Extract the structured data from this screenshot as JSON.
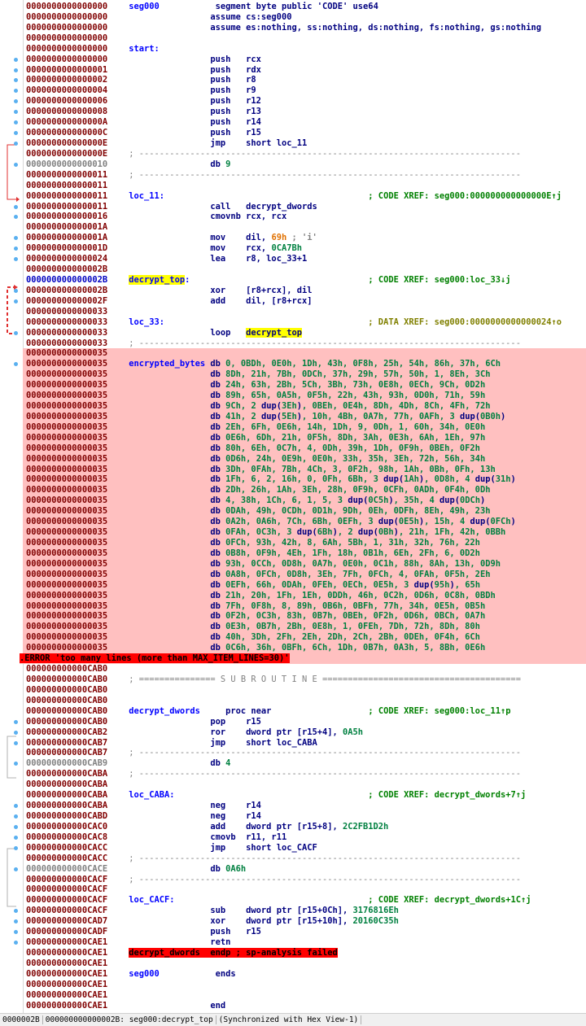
{
  "view": "IDA View (disassembly listing)",
  "status_bar": {
    "offset": "0000002B",
    "location": "000000000000002B: seg000:decrypt_top",
    "sync": "(Synchronized with Hex View-1)"
  },
  "lines": [
    {
      "addr": "0000000000000000",
      "label": "seg000",
      "code": "segment byte public 'CODE' use64",
      "kind": "dir"
    },
    {
      "addr": "0000000000000000",
      "code": "assume cs:seg000",
      "kind": "dir"
    },
    {
      "addr": "0000000000000000",
      "code": "assume es:nothing, ss:nothing, ds:nothing, fs:nothing, gs:nothing",
      "kind": "dir"
    },
    {
      "addr": "0000000000000000"
    },
    {
      "addr": "0000000000000000",
      "label": "start:"
    },
    {
      "addr": "0000000000000000",
      "mn": "push",
      "ops": "rcx",
      "dot": true
    },
    {
      "addr": "0000000000000001",
      "mn": "push",
      "ops": "rdx",
      "dot": true
    },
    {
      "addr": "0000000000000002",
      "mn": "push",
      "ops": "r8",
      "dot": true
    },
    {
      "addr": "0000000000000004",
      "mn": "push",
      "ops": "r9",
      "dot": true
    },
    {
      "addr": "0000000000000006",
      "mn": "push",
      "ops": "r12",
      "dot": true
    },
    {
      "addr": "0000000000000008",
      "mn": "push",
      "ops": "r13",
      "dot": true
    },
    {
      "addr": "000000000000000A",
      "mn": "push",
      "ops": "r14",
      "dot": true
    },
    {
      "addr": "000000000000000C",
      "mn": "push",
      "ops": "r15",
      "dot": true
    },
    {
      "addr": "000000000000000E",
      "mn": "jmp",
      "ops": "short loc_11",
      "dot": true
    },
    {
      "addr": "000000000000000E",
      "sep": "dash"
    },
    {
      "addr": "0000000000000010",
      "gray": true,
      "mn": "db",
      "num": "9",
      "dot": true
    },
    {
      "addr": "0000000000000011",
      "sep": "dash"
    },
    {
      "addr": "0000000000000011"
    },
    {
      "addr": "0000000000000011",
      "label": "loc_11:",
      "xref": "; CODE XREF: seg000:000000000000000E↑j"
    },
    {
      "addr": "0000000000000011",
      "mn": "call",
      "ops": "decrypt_dwords",
      "dot": true
    },
    {
      "addr": "0000000000000016",
      "mn": "cmovnb",
      "ops": "rcx, rcx",
      "dot": true
    },
    {
      "addr": "000000000000001A"
    },
    {
      "addr": "000000000000001A",
      "mn": "mov",
      "ops": "dil, ",
      "num_orange": "69h",
      "cmt": " ; 'i'",
      "dot": true
    },
    {
      "addr": "000000000000001D",
      "mn": "mov",
      "ops": "rcx, ",
      "num": "0CA7Bh",
      "dot": true
    },
    {
      "addr": "0000000000000024",
      "mn": "lea",
      "ops": "r8, loc_33+1",
      "dot": true
    },
    {
      "addr": "000000000000002B"
    },
    {
      "addr": "000000000000002B",
      "blue_addr": true,
      "label_hl": "decrypt_top",
      "label_suffix": ":",
      "xref": "; CODE XREF: seg000:loc_33↓j"
    },
    {
      "addr": "000000000000002B",
      "mn": "xor",
      "ops": "[r8+rcx], dil",
      "dot": true
    },
    {
      "addr": "000000000000002F",
      "mn": "add",
      "ops": "dil, [r8+rcx]",
      "dot": true
    },
    {
      "addr": "0000000000000033"
    },
    {
      "addr": "0000000000000033",
      "label": "loc_33:",
      "dxref": "; DATA XREF: seg000:0000000000000024↑o"
    },
    {
      "addr": "0000000000000033",
      "mn": "loop",
      "ops_hl": "decrypt_top",
      "dot": true
    },
    {
      "addr": "0000000000000033",
      "sep": "dash"
    }
  ],
  "encrypted": {
    "addr": "0000000000000035",
    "label": "encrypted_bytes",
    "rows": [
      "0, 0BDh, 0E0h, 1Dh, 43h, 0F8h, 25h, 54h, 86h, 37h, 6Ch",
      "8Dh, 21h, 7Bh, 0DCh, 37h, 29h, 57h, 50h, 1, 8Eh, 3Ch",
      "24h, 63h, 2Bh, 5Ch, 3Bh, 73h, 0E8h, 0ECh, 9Ch, 0D2h",
      "89h, 65h, 0A5h, 0F5h, 22h, 43h, 93h, 0D0h, 71h, 59h",
      "9Ch, 2 dup(3Eh), 0BEh, 0E4h, 8Dh, 4Dh, 8Ch, 4Fh, 72h",
      "41h, 2 dup(5Eh), 10h, 4Bh, 0A7h, 77h, 0AFh, 3 dup(0B0h)",
      "2Eh, 6Fh, 0E6h, 14h, 1Dh, 9, 0Dh, 1, 60h, 34h, 0E0h",
      "0E6h, 6Dh, 21h, 0F5h, 8Dh, 3Ah, 0E3h, 6Ah, 1Eh, 97h",
      "80h, 6Eh, 0C7h, 4, 0Dh, 39h, 1Dh, 0F9h, 0BEh, 0F2h",
      "0D6h, 24h, 0E9h, 0E0h, 33h, 35h, 3Eh, 72h, 56h, 34h",
      "3Dh, 0FAh, 7Bh, 4Ch, 3, 0F2h, 98h, 1Ah, 0Bh, 0Fh, 13h",
      "1Fh, 6, 2, 16h, 0, 0Fh, 6Bh, 3 dup(1Ah), 0D8h, 4 dup(31h)",
      "2Dh, 26h, 1Ah, 3Eh, 28h, 0F9h, 0CFh, 0ADh, 0F4h, 0Dh",
      "4, 38h, 1Ch, 6, 1, 5, 3 dup(0C5h), 35h, 4 dup(0DCh)",
      "0DAh, 49h, 0CDh, 0D1h, 9Dh, 0Eh, 0DFh, 8Eh, 49h, 23h",
      "0A2h, 0A6h, 7Ch, 6Bh, 0EFh, 3 dup(0E5h), 15h, 4 dup(0FCh)",
      "0FAh, 0C3h, 3 dup(6Bh), 2 dup(0Bh), 21h, 1Fh, 42h, 0BBh",
      "0FCh, 93h, 42h, 8, 6Ah, 5Bh, 1, 31h, 32h, 76h, 22h",
      "0B8h, 0F9h, 4Eh, 1Fh, 18h, 0B1h, 6Eh, 2Fh, 6, 0D2h",
      "93h, 0CCh, 0D8h, 0A7h, 0E0h, 0C1h, 88h, 8Ah, 13h, 0D9h",
      "0A8h, 0FCh, 0D8h, 3Eh, 7Fh, 0FCh, 4, 0FAh, 0F5h, 2Eh",
      "0EFh, 66h, 0DAh, 0FEh, 0ECh, 0E5h, 3 dup(95h), 65h",
      "21h, 20h, 1Fh, 1Eh, 0DDh, 46h, 0C2h, 0D6h, 0C8h, 0BDh",
      "7Fh, 0F8h, 8, 89h, 0B6h, 0BFh, 77h, 34h, 0E5h, 0B5h",
      "0F2h, 0C3h, 83h, 0B7h, 0BEh, 0F2h, 0D6h, 0BCh, 0A7h",
      "0E3h, 0B7h, 2Bh, 0E8h, 1, 0FEh, 7Dh, 72h, 8Dh, 80h",
      "40h, 3Dh, 2Fh, 2Eh, 2Dh, 2Ch, 2Bh, 0DEh, 0F4h, 6Ch",
      "0C6h, 36h, 0BFh, 6Ch, 1Dh, 0B7h, 0A3h, 5, 8Bh, 0E6h"
    ],
    "error": ".ERROR 'too many lines (more than MAX_ITEM_LINES=30)'"
  },
  "lines2": [
    {
      "addr": "000000000000CAB0"
    },
    {
      "addr": "000000000000CAB0",
      "sep": "sub",
      "sep_text": "; =============== S U B R O U T I N E ======================================="
    },
    {
      "addr": "000000000000CAB0"
    },
    {
      "addr": "000000000000CAB0"
    },
    {
      "addr": "000000000000CAB0",
      "label": "decrypt_dwords",
      "proc": "proc near",
      "xref": "; CODE XREF: seg000:loc_11↑p"
    },
    {
      "addr": "000000000000CAB0",
      "mn": "pop",
      "ops": "r15",
      "dot": true
    },
    {
      "addr": "000000000000CAB2",
      "mn": "ror",
      "ops": "dword ptr [r15+4], ",
      "num": "0A5h",
      "dot": true
    },
    {
      "addr": "000000000000CAB7",
      "mn": "jmp",
      "ops": "short loc_CABA",
      "dot": true
    },
    {
      "addr": "000000000000CAB7",
      "sep": "dash"
    },
    {
      "addr": "000000000000CAB9",
      "gray": true,
      "mn": "db",
      "num": "4",
      "dot": true
    },
    {
      "addr": "000000000000CABA",
      "sep": "dash"
    },
    {
      "addr": "000000000000CABA"
    },
    {
      "addr": "000000000000CABA",
      "label": "loc_CABA:",
      "xref": "; CODE XREF: decrypt_dwords+7↑j"
    },
    {
      "addr": "000000000000CABA",
      "mn": "neg",
      "ops": "r14",
      "dot": true
    },
    {
      "addr": "000000000000CABD",
      "mn": "neg",
      "ops": "r14",
      "dot": true
    },
    {
      "addr": "000000000000CAC0",
      "mn": "add",
      "ops": "dword ptr [r15+8], ",
      "num": "2C2FB1D2h",
      "dot": true
    },
    {
      "addr": "000000000000CAC8",
      "mn": "cmovb",
      "ops": "r11, r11",
      "dot": true
    },
    {
      "addr": "000000000000CACC",
      "mn": "jmp",
      "ops": "short loc_CACF",
      "dot": true
    },
    {
      "addr": "000000000000CACC",
      "sep": "dash"
    },
    {
      "addr": "000000000000CACE",
      "gray": true,
      "mn": "db",
      "num": "0A6h",
      "dot": true
    },
    {
      "addr": "000000000000CACF",
      "sep": "dash"
    },
    {
      "addr": "000000000000CACF"
    },
    {
      "addr": "000000000000CACF",
      "label": "loc_CACF:",
      "xref": "; CODE XREF: decrypt_dwords+1C↑j"
    },
    {
      "addr": "000000000000CACF",
      "mn": "sub",
      "ops": "dword ptr [r15+0Ch], ",
      "num": "3176816Eh",
      "dot": true
    },
    {
      "addr": "000000000000CAD7",
      "mn": "xor",
      "ops": "dword ptr [r15+10h], ",
      "num": "20160C35h",
      "dot": true
    },
    {
      "addr": "000000000000CADF",
      "mn": "push",
      "ops": "r15",
      "dot": true
    },
    {
      "addr": "000000000000CAE1",
      "mn": "retn",
      "ops": "",
      "dot": true
    },
    {
      "addr": "000000000000CAE1",
      "errline": "decrypt_dwords  endp ; sp-analysis failed"
    },
    {
      "addr": "000000000000CAE1"
    },
    {
      "addr": "000000000000CAE1",
      "label": "seg000",
      "code": "ends",
      "kind": "dir"
    },
    {
      "addr": "000000000000CAE1"
    },
    {
      "addr": "000000000000CAE1"
    },
    {
      "addr": "000000000000CAE1",
      "code": "end",
      "kind": "dir"
    }
  ],
  "colors": {
    "address": "#800000",
    "label": "#0000ff",
    "mnemonic": "#000080",
    "number": "#008040",
    "xref": "#008000",
    "highlight": "#ffff00",
    "error": "#ff0000",
    "data_bg": "#ffc0c0"
  }
}
